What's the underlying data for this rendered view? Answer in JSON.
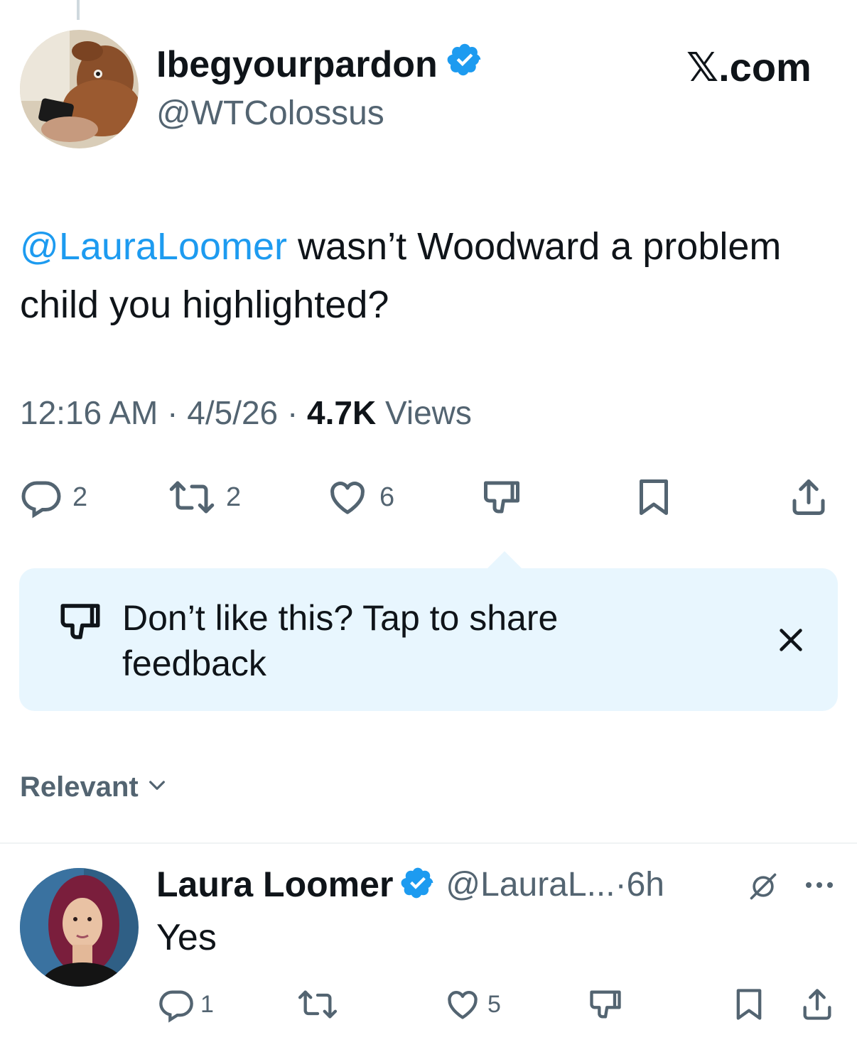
{
  "source_label": "𝕏.com",
  "tweet": {
    "author_name": "Ibegyourpardon",
    "author_handle": "@WTColossus",
    "mention": "@LauraLoomer",
    "text": " wasn’t Woodward a problem child you highlighted?",
    "time": "12:16 AM",
    "date": "4/5/26",
    "views_count": "4.7K",
    "views_label": "Views",
    "replies": "2",
    "reposts": "2",
    "likes": "6"
  },
  "feedback_nudge": {
    "text": "Don’t like this? Tap to share feedback"
  },
  "sort": {
    "label": "Relevant"
  },
  "reply": {
    "author_name": "Laura Loomer",
    "author_handle": "@LauraL...",
    "time": "6h",
    "text": "Yes",
    "replies": "1",
    "likes": "5"
  },
  "colors": {
    "accent": "#1d9bf0",
    "secondary_text": "#536471",
    "nudge_background": "#e8f6fe"
  },
  "icons": [
    "verified-badge-icon",
    "reply-icon",
    "repost-icon",
    "like-icon",
    "dislike-icon",
    "bookmark-icon",
    "share-icon",
    "close-icon",
    "chevron-down-icon",
    "grok-icon",
    "more-icon"
  ]
}
